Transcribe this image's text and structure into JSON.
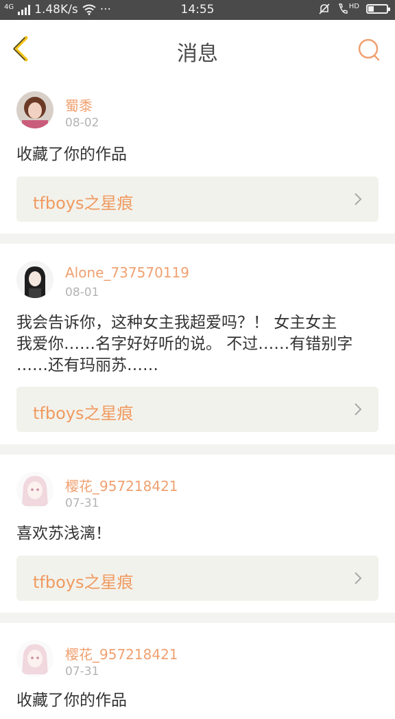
{
  "status_bar": {
    "network": "4G",
    "speed": "1.48K/s",
    "more": "···",
    "time": "14:55",
    "hd": "HD",
    "battery_level": 0.3
  },
  "header": {
    "title": "消息"
  },
  "colors": {
    "accent": "#f0a070",
    "card_bg": "#f2f2ec",
    "separator": "#f3f3f1"
  },
  "messages": [
    {
      "user": "蜀黍",
      "date": "08-02",
      "text": "收藏了你的作品",
      "work": "tfboys之星痕"
    },
    {
      "user": "Alone_737570119",
      "date": "08-01",
      "text_lines": [
        "我会告诉你，这种女主我超爱吗？！ 女主女主",
        "我爱你……名字好好听的说。 不过……有错别字",
        "……还有玛丽苏……"
      ],
      "work": "tfboys之星痕"
    },
    {
      "user": "樱花_957218421",
      "date": "07-31",
      "text": "喜欢苏浅漓！",
      "work": "tfboys之星痕"
    },
    {
      "user": "樱花_957218421",
      "date": "07-31",
      "text": "收藏了你的作品"
    }
  ]
}
